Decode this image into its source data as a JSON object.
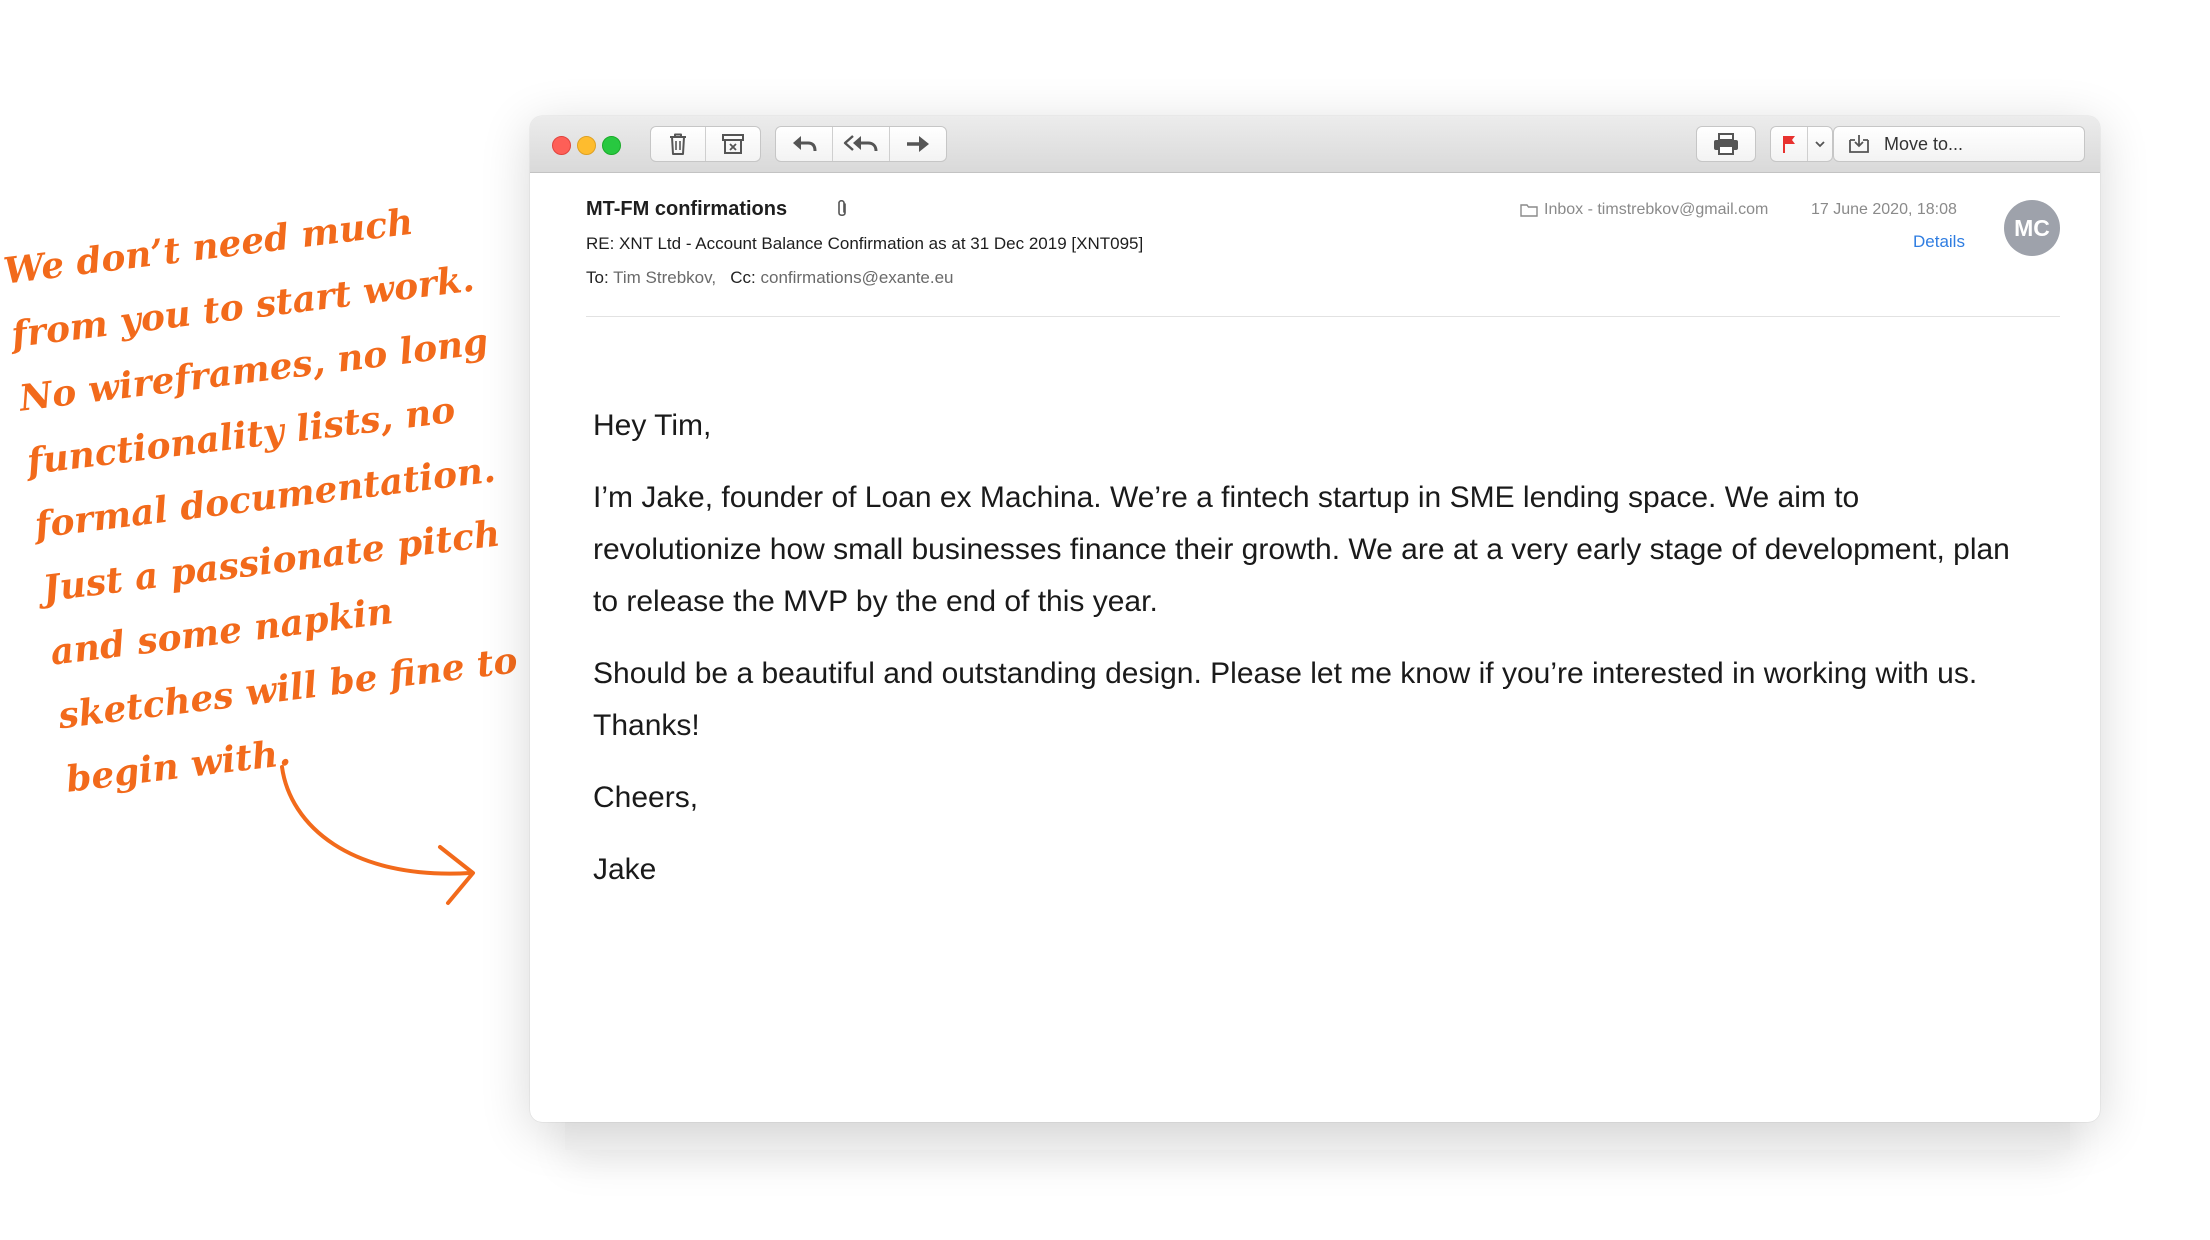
{
  "note": {
    "lines": [
      "We don’t need much",
      "from you to start work.",
      "No wireframes, no long",
      "functionality lists, no",
      "formal documentation.",
      "Just a passionate pitch",
      "and some napkin",
      "sketches will be fine to",
      "begin with."
    ],
    "color": "#f26a1b"
  },
  "toolbar": {
    "delete_icon": "trash-icon",
    "archive_icon": "archive-icon",
    "reply_icon": "reply-icon",
    "reply_all_icon": "reply-all-icon",
    "forward_icon": "forward-icon",
    "print_icon": "printer-icon",
    "flag_icon": "flag-icon",
    "move_label": "Move to..."
  },
  "message": {
    "sender": "MT-FM confirmations",
    "subject": "RE: XNT Ltd - Account Balance Confirmation as at 31 Dec 2019 [XNT095]",
    "to_label": "To:",
    "to_value": "Tim Strebkov,",
    "cc_label": "Cc:",
    "cc_value": "confirmations@exante.eu",
    "folder": "Inbox - timstrebkov@gmail.com",
    "date": "17 June 2020, 18:08",
    "details_label": "Details",
    "avatar_initials": "MC",
    "body": [
      "Hey Tim,",
      "I’m Jake, founder of Loan ex Machina. We’re a fintech startup in SME lending space. We aim to revolutionize how small businesses finance their growth. We are at a very early stage of development, plan to release the MVP by the end of this year.",
      "Should be a beautiful and outstanding design. Please let me know if you’re interested in working with us. Thanks!",
      "Cheers,",
      "Jake"
    ]
  },
  "colors": {
    "accent_link": "#2f7de1",
    "flag": "#e8322f",
    "avatar_bg": "#9ea2ab"
  }
}
